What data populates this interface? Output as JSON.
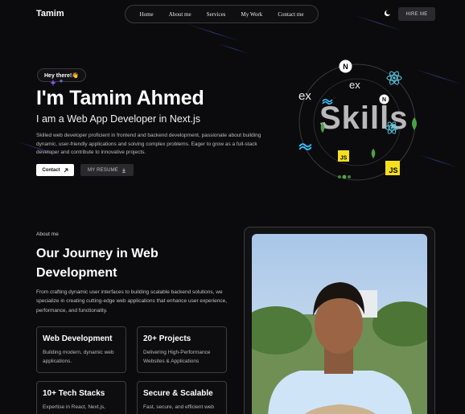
{
  "nav": {
    "brand": "Tamim",
    "links": [
      "Home",
      "About me",
      "Services",
      "My Work",
      "Contact me"
    ],
    "hire_label": "HIRE ME",
    "theme_icon": "moon-icon"
  },
  "hero": {
    "greeting": "Hey there!👋",
    "title": "I'm Tamim Ahmed",
    "subtitle": "I am a Web App Developer in  Next.js",
    "description": "Skilled web developer proficient in frontend and backend development, passionate about building dynamic, user-friendly applications and solving complex problems. Eager to grow as a full-stack developer and contribute to innovative projects.",
    "contact_label": "Contact",
    "resume_label": "MY RESUME"
  },
  "skills": {
    "word": "Skills",
    "ex_label": "ex",
    "js_label": "JS",
    "n_label": "N",
    "icons": [
      "nextjs-icon",
      "react-icon",
      "express-icon",
      "tailwind-icon",
      "javascript-icon",
      "mongodb-icon",
      "nodejs-icon"
    ]
  },
  "about": {
    "label": "About me",
    "title": "Our Journey in Web Development",
    "description": "From crafting dynamic user interfaces to building scalable backend solutions, we specialize in creating cutting-edge web applications that enhance user experience, performance, and functionality.",
    "cards": [
      {
        "title": "Web Development",
        "desc": "Building modern, dynamic web applications."
      },
      {
        "title": "20+ Projects",
        "desc": "Delivering High-Performance Websites & Applications"
      },
      {
        "title": "10+ Tech Stacks",
        "desc": "Expertise in React, Next.js,"
      },
      {
        "title": "Secure & Scalable",
        "desc": "Fast, secure, and efficient web"
      }
    ]
  },
  "colors": {
    "background": "#0b0b0d",
    "streak": "#4a5bd6",
    "react": "#58c4dc",
    "js": "#f7df1e",
    "mongo": "#47a248"
  }
}
